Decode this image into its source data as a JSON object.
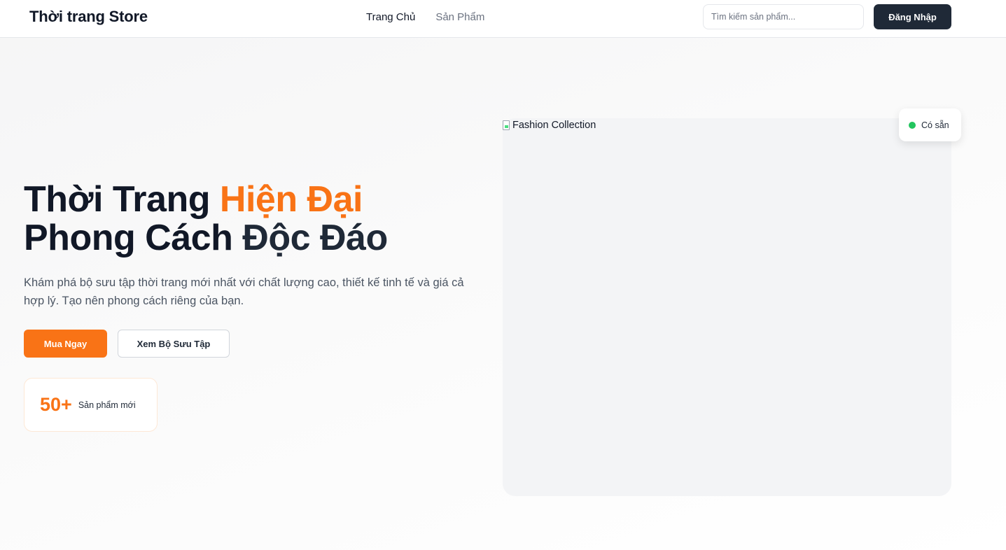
{
  "header": {
    "brand": "Thời trang Store",
    "nav": [
      {
        "label": "Trang Chủ"
      },
      {
        "label": "Sản Phẩm"
      }
    ],
    "search_placeholder": "Tìm kiếm sản phẩm...",
    "login_label": "Đăng Nhập"
  },
  "hero": {
    "title_part1": "Thời Trang ",
    "title_accent": "Hiện Đại",
    "title_line2_part1": "Phong Cách ",
    "title_line2_part2": "Độc Đáo",
    "description": "Khám phá bộ sưu tập thời trang mới nhất với chất lượng cao, thiết kế tinh tế và giá cả hợp lý. Tạo nên phong cách riêng của bạn.",
    "primary_button": "Mua Ngay",
    "secondary_button": "Xem Bộ Sưu Tập",
    "stat": {
      "value": "50+",
      "label": "Sản phẩm mới"
    }
  },
  "image": {
    "alt": "Fashion Collection",
    "badge": "Có sẵn"
  },
  "colors": {
    "accent": "#f97316",
    "dark": "#1f2937",
    "status_green": "#22c55e"
  },
  "icons": {
    "broken_image": "broken-image-icon",
    "status_dot": "available-dot-icon"
  }
}
